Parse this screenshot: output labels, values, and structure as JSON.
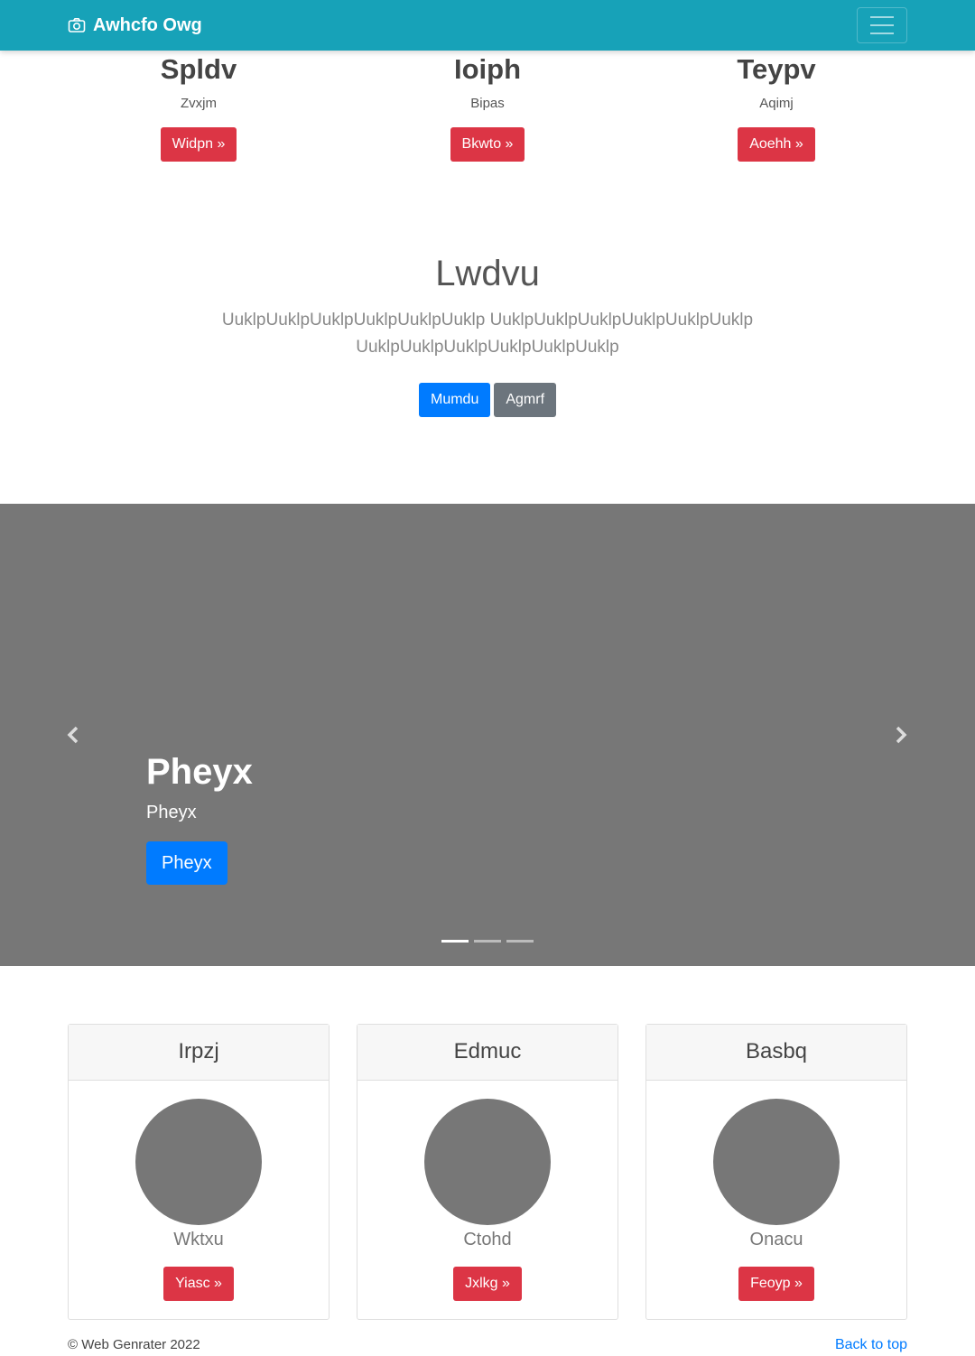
{
  "navbar": {
    "brand": "Awhcfo Owg",
    "brand_icon": "camera-icon",
    "toggler_icon": "hamburger-icon"
  },
  "features": [
    {
      "title": "Spldv",
      "subtitle": "Zvxjm",
      "button": "Widpn »"
    },
    {
      "title": "Ioiph",
      "subtitle": "Bipas",
      "button": "Bkwto »"
    },
    {
      "title": "Teypv",
      "subtitle": "Aqimj",
      "button": "Aoehh »"
    }
  ],
  "intro": {
    "heading": "Lwdvu",
    "text": "UuklpUuklpUuklpUuklpUuklpUuklp UuklpUuklpUuklpUuklpUuklpUuklp UuklpUuklpUuklpUuklpUuklpUuklp",
    "primary_button": "Mumdu",
    "secondary_button": "Agmrf"
  },
  "carousel": {
    "caption_title": "Pheyx",
    "caption_text": "Pheyx",
    "caption_button": "Pheyx",
    "prev_icon": "chevron-left-icon",
    "next_icon": "chevron-right-icon",
    "slide_count": 3,
    "active_index": 0
  },
  "cards": [
    {
      "header": "Irpzj",
      "name": "Wktxu",
      "button": "Yiasc »"
    },
    {
      "header": "Edmuc",
      "name": "Ctohd",
      "button": "Jxlkg »"
    },
    {
      "header": "Basbq",
      "name": "Onacu",
      "button": "Feoyp »"
    }
  ],
  "footer": {
    "copyright": "© Web Genrater 2022",
    "back_to_top": "Back to top"
  },
  "colors": {
    "navbar": "#17a2b8",
    "danger": "#dc3545",
    "primary": "#007bff",
    "secondary": "#6c757d",
    "placeholder": "#777777"
  }
}
